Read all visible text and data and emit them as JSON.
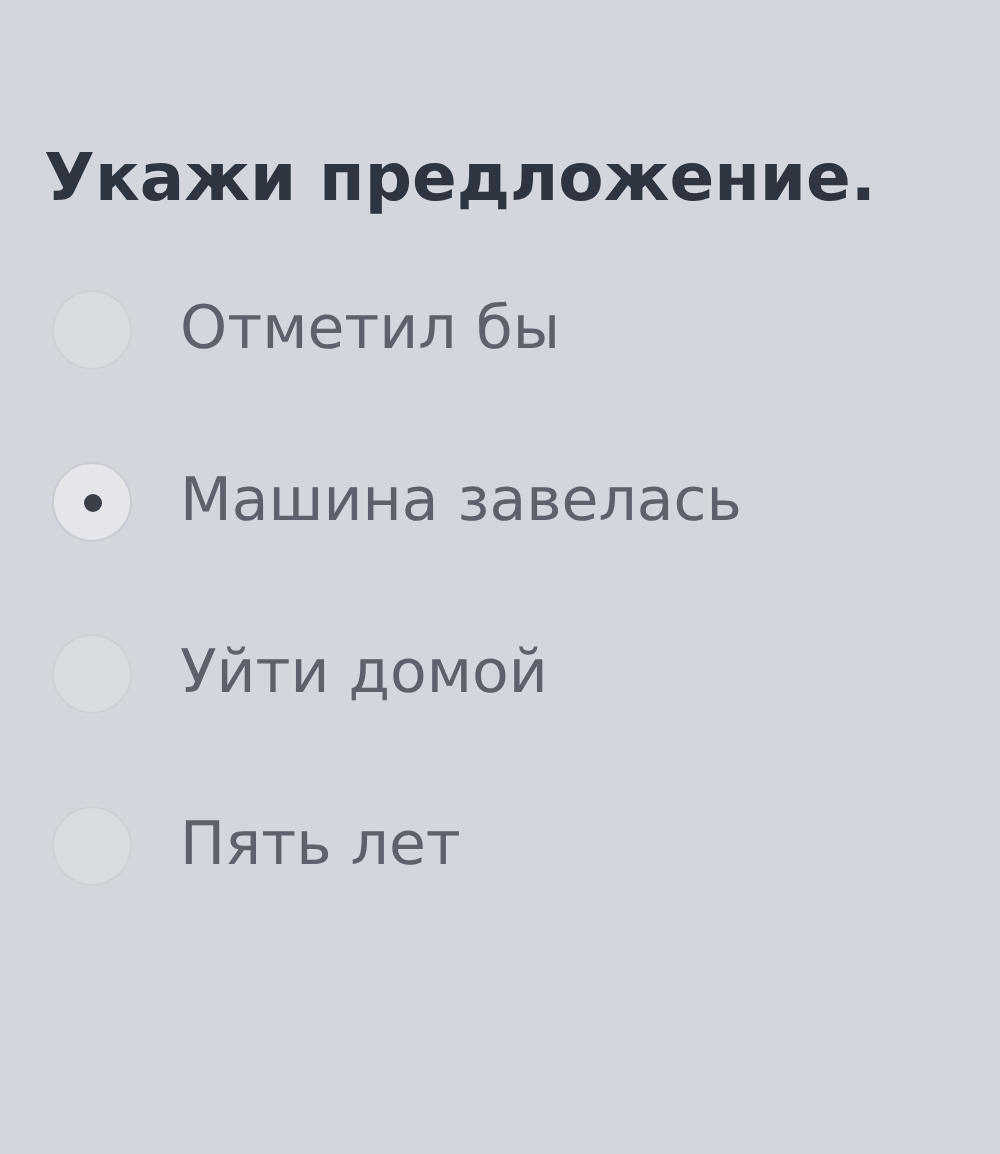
{
  "question": "Укажи предложение.",
  "options": [
    {
      "label": "Отметил бы",
      "selected": false
    },
    {
      "label": "Машина завелась",
      "selected": true
    },
    {
      "label": "Уйти домой",
      "selected": false
    },
    {
      "label": "Пять лет",
      "selected": false
    }
  ]
}
